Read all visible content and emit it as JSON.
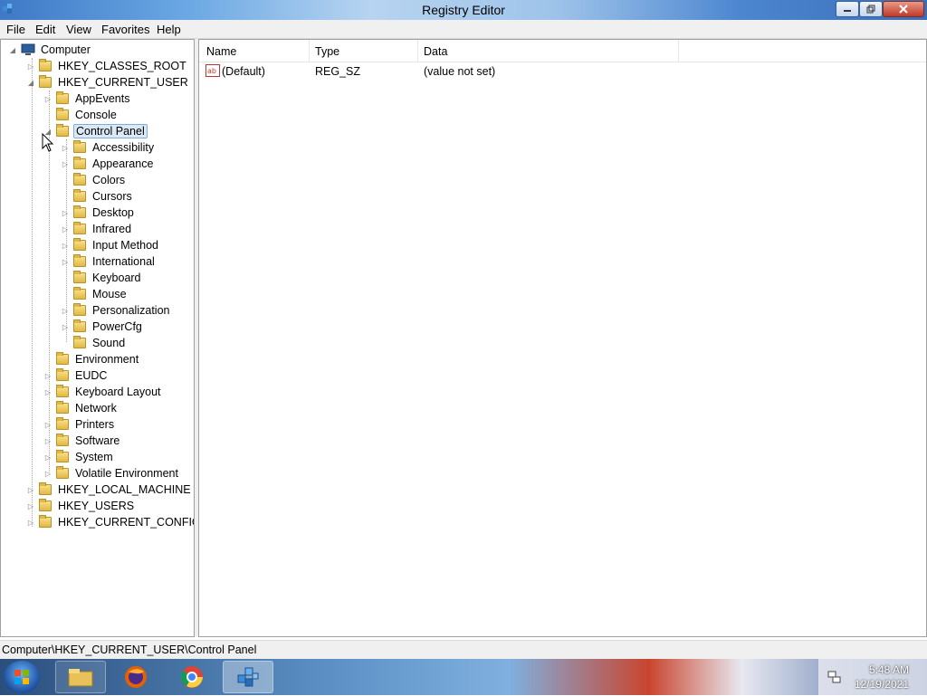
{
  "window": {
    "title": "Registry Editor"
  },
  "menu": [
    "File",
    "Edit",
    "View",
    "Favorites",
    "Help"
  ],
  "tree": {
    "root": "Computer",
    "hkcr": "HKEY_CLASSES_ROOT",
    "hkcu": "HKEY_CURRENT_USER",
    "hkcu_children": [
      "AppEvents",
      "Console",
      "Control Panel",
      "Environment",
      "EUDC",
      "Keyboard Layout",
      "Network",
      "Printers",
      "Software",
      "System",
      "Volatile Environment"
    ],
    "control_panel_children": [
      "Accessibility",
      "Appearance",
      "Colors",
      "Cursors",
      "Desktop",
      "Infrared",
      "Input Method",
      "International",
      "Keyboard",
      "Mouse",
      "Personalization",
      "PowerCfg",
      "Sound"
    ],
    "hklm": "HKEY_LOCAL_MACHINE",
    "hku": "HKEY_USERS",
    "hkcc": "HKEY_CURRENT_CONFIG",
    "selected": "Control Panel"
  },
  "list": {
    "columns": [
      "Name",
      "Type",
      "Data"
    ],
    "rows": [
      {
        "name": "(Default)",
        "type": "REG_SZ",
        "data": "(value not set)"
      }
    ]
  },
  "status": {
    "path": "Computer\\HKEY_CURRENT_USER\\Control Panel"
  },
  "taskbar": {
    "items": [
      "explorer-icon",
      "firefox-icon",
      "chrome-icon",
      "regedit-icon"
    ],
    "time": "5:48 AM",
    "date": "12/19/2021"
  }
}
